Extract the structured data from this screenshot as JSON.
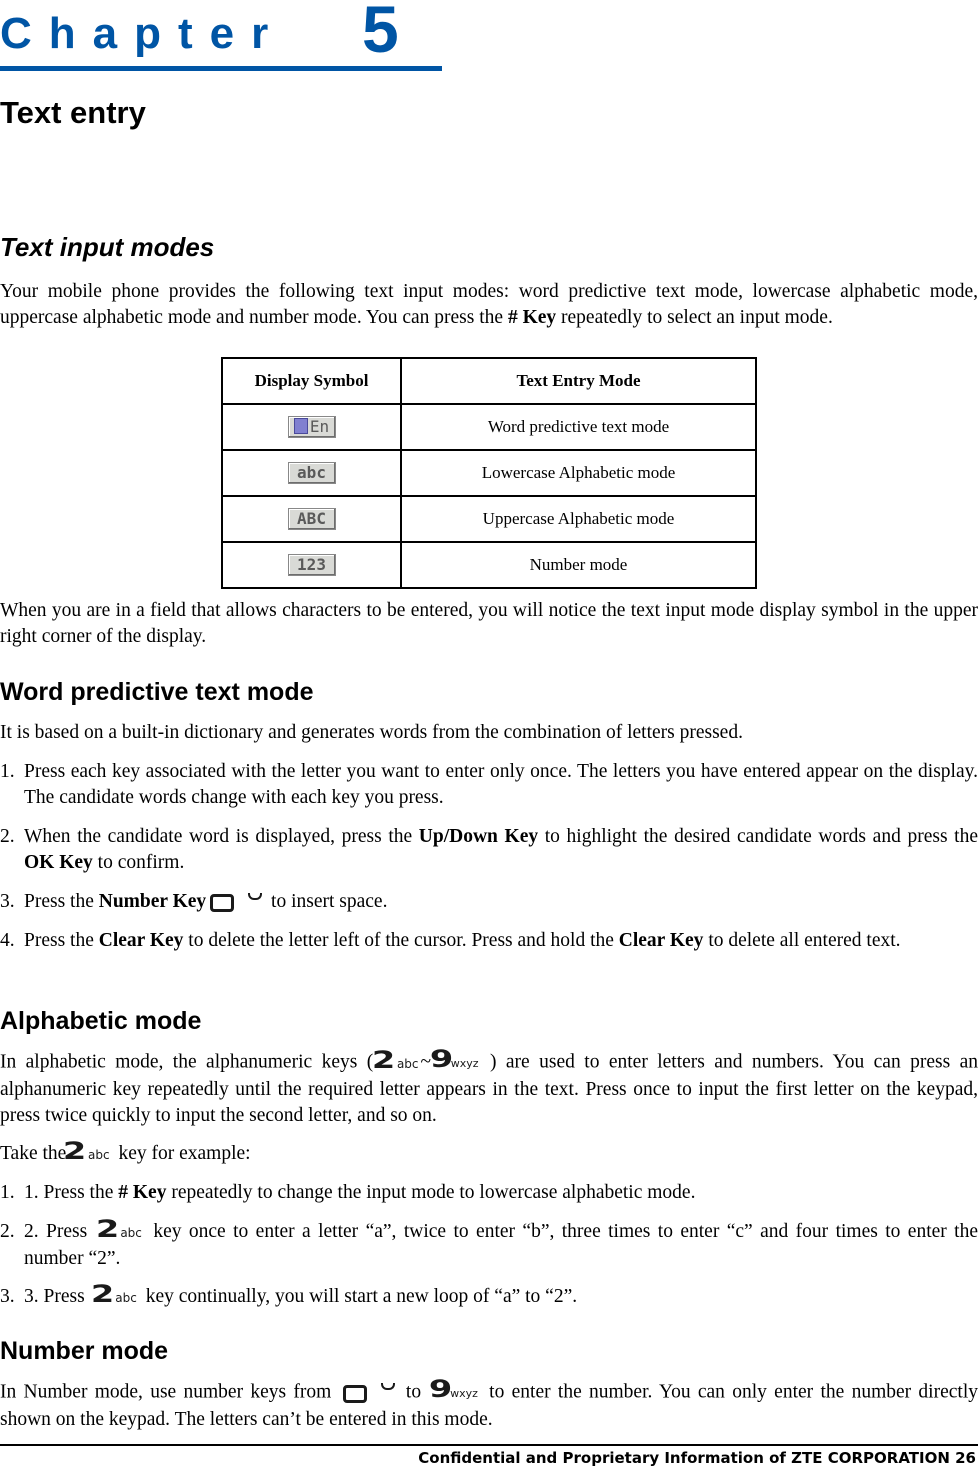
{
  "chapter": {
    "word": "Chapter",
    "number": "5"
  },
  "title": "Text entry",
  "section_text_input_modes": {
    "heading": "Text input modes",
    "intro_before_key": "Your mobile phone provides the following text input modes: word predictive text mode, lowercase alphabetic mode, uppercase alphabetic mode and number mode. You can press the ",
    "intro_key": "# Key",
    "intro_after_key": " repeatedly to select an input mode.",
    "table": {
      "headers": [
        "Display Symbol",
        "Text Entry Mode"
      ],
      "rows": [
        {
          "icon": "word-predictive-icon",
          "symbol_text": "En",
          "mode": "Word predictive text mode"
        },
        {
          "icon": "lowercase-abc-icon",
          "symbol_text": "abc",
          "mode": "Lowercase Alphabetic mode"
        },
        {
          "icon": "uppercase-abc-icon",
          "symbol_text": "ABC",
          "mode": "Uppercase Alphabetic mode"
        },
        {
          "icon": "number-123-icon",
          "symbol_text": "123",
          "mode": "Number mode"
        }
      ]
    },
    "after_table": "When you are in a field that allows characters to be entered, you will notice the text input mode display symbol in the upper right corner of the display."
  },
  "section_word_predictive": {
    "heading": "Word predictive text mode",
    "intro": "It is based on a built-in dictionary and generates words from the combination of letters pressed.",
    "items": [
      {
        "num": "1.",
        "text": "Press each key associated with the letter you want to enter only once. The letters you have entered appear on the display. The candidate words change with each key you press."
      },
      {
        "num": "2.",
        "pre": "When the candidate word is displayed, press the ",
        "bold1": "Up/Down Key",
        "mid": " to highlight the desired candidate words and press the ",
        "bold2": "OK Key",
        "post": " to confirm."
      },
      {
        "num": "3.",
        "pre": "Press the ",
        "bold1": "Number Key",
        "post": " to insert space."
      },
      {
        "num": "4.",
        "pre": "Press the ",
        "bold1": "Clear Key",
        "mid": " to delete the letter left of the cursor. Press and hold the ",
        "bold2": "Clear Key",
        "post": " to delete all entered text."
      }
    ]
  },
  "section_alphabetic": {
    "heading": "Alphabetic mode",
    "p1_pre": "In alphabetic mode, the alphanumeric keys (",
    "p1_tilde": "~",
    "p1_post": " ) are used to enter letters and numbers. You can press an alphanumeric key repeatedly until the required letter appears in the text. Press once to input the first letter on the keypad, press twice quickly to input the second letter, and so on.",
    "example_pre": "Take the",
    "example_post": " key for example:",
    "items": [
      {
        "num": "1.",
        "pre": "1. Press the ",
        "bold1": "# Key",
        "post": " repeatedly to change the input mode to lowercase alphabetic mode."
      },
      {
        "num": "2.",
        "pre": "2. Press ",
        "post": " key once to enter a letter “a”, twice to enter “b”, three times to enter “c” and four times to enter the number “2”."
      },
      {
        "num": "3.",
        "pre": "3. Press ",
        "post": " key continually, you will start a new loop of “a” to “2”."
      }
    ]
  },
  "section_number": {
    "heading": "Number mode",
    "p_pre": "In Number mode, use number keys from ",
    "p_mid": " to ",
    "p_post": " to enter the number. You can only enter the number directly shown on the keypad. The letters can’t be entered in this mode."
  },
  "keys": {
    "two": {
      "digit": "2",
      "letters": "abc"
    },
    "nine": {
      "digit": "9",
      "letters": "wxyz"
    },
    "zero": {
      "digit": "0",
      "letters": "space"
    }
  },
  "footer": "Confidential and Proprietary Information of ZTE CORPORATION 26",
  "colors": {
    "brand_blue": "#0055a5"
  }
}
